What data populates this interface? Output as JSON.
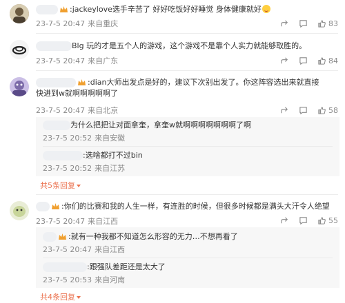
{
  "comments": [
    {
      "text": ":jackeylove选手辛苦了 好好吃饭好好睡觉 身体健康就好",
      "time": "23-7-5 20:47",
      "location": "来自重庆",
      "likes": "83",
      "avatar_color": "#8a7a5a"
    },
    {
      "text": "Blg 玩的才是五个人的游戏，这个游戏不是靠个人实力就能够取胜的。",
      "time": "23-7-5 20:47",
      "location": "来自广东",
      "likes": "84",
      "avatar_color": "#222222"
    },
    {
      "text": ":dian大师出发点是好的，建议下次别出发了。你这阵容选出来就直接快进到w就啊啊啊啊啊了",
      "time": "23-7-5 20:47",
      "location": "来自北京",
      "likes": "58",
      "avatar_color": "#7b6aa8",
      "replies": [
        {
          "text": "为什么把把让对面拿奎，拿奎w就啊啊啊啊啊啊啊了啊",
          "time": "23-7-5 20:52",
          "location": "来自安徽"
        },
        {
          "text": ":选啥都打不过bin",
          "time": "23-7-5 20:52",
          "location": "来自江苏"
        }
      ],
      "more": "共5条回复"
    },
    {
      "text": ":你们的比赛和我的人生一样，有连胜的时候，但很多时候都是满头大汗令人绝望",
      "time": "23-7-5 20:47",
      "location": "来自江西",
      "likes": "55",
      "avatar_color": "#b9c98a",
      "replies": [
        {
          "text": ":就有一种我都不知道怎么形容的无力…不想再看了",
          "time": "23-7-5 20:47",
          "location": "来自江西"
        },
        {
          "text": ":跟强队差距还是太大了",
          "time": "23-7-5 20:53",
          "location": "来自河南"
        }
      ],
      "more": "共4条回复"
    }
  ],
  "colors": {
    "accent": "#eb7350",
    "meta": "#8a8a8a"
  },
  "icons": [
    "share-icon",
    "comment-icon",
    "like-icon",
    "crown-icon"
  ]
}
